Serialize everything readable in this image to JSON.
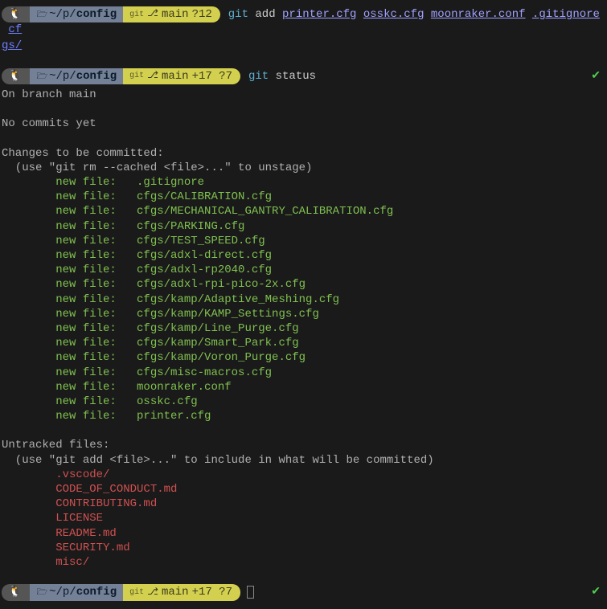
{
  "prompt1": {
    "os_icon": "🐧",
    "path_prefix": "~/p/",
    "path_bold": "config",
    "git_label": "git",
    "branch_icon": "⎇",
    "branch": "main",
    "status_suffix": "?12",
    "cmd": "git",
    "cmd_arg": "add",
    "files": [
      "printer.cfg",
      "osskc.cfg",
      "moonraker.conf",
      ".gitignore"
    ],
    "file_wrap1": "cf",
    "file_wrap2": "gs/"
  },
  "prompt2": {
    "os_icon": "🐧",
    "path_prefix": "~/p/",
    "path_bold": "config",
    "git_label": "git",
    "branch_icon": "⎇",
    "branch": "main",
    "status_suffix": "+17 ?7",
    "cmd": "git",
    "cmd_arg": "status",
    "check": "✔"
  },
  "output": {
    "line1": "On branch main",
    "line2": "",
    "line3": "No commits yet",
    "line4": "",
    "changes_header": "Changes to be committed:",
    "changes_hint": "  (use \"git rm --cached <file>...\" to unstage)",
    "new_file_label": "new file:   ",
    "staged": [
      ".gitignore",
      "cfgs/CALIBRATION.cfg",
      "cfgs/MECHANICAL_GANTRY_CALIBRATION.cfg",
      "cfgs/PARKING.cfg",
      "cfgs/TEST_SPEED.cfg",
      "cfgs/adxl-direct.cfg",
      "cfgs/adxl-rp2040.cfg",
      "cfgs/adxl-rpi-pico-2x.cfg",
      "cfgs/kamp/Adaptive_Meshing.cfg",
      "cfgs/kamp/KAMP_Settings.cfg",
      "cfgs/kamp/Line_Purge.cfg",
      "cfgs/kamp/Smart_Park.cfg",
      "cfgs/kamp/Voron_Purge.cfg",
      "cfgs/misc-macros.cfg",
      "moonraker.conf",
      "osskc.cfg",
      "printer.cfg"
    ],
    "untracked_header": "Untracked files:",
    "untracked_hint": "  (use \"git add <file>...\" to include in what will be committed)",
    "untracked": [
      ".vscode/",
      "CODE_OF_CONDUCT.md",
      "CONTRIBUTING.md",
      "LICENSE",
      "README.md",
      "SECURITY.md",
      "misc/"
    ]
  },
  "prompt3": {
    "os_icon": "🐧",
    "path_prefix": "~/p/",
    "path_bold": "config",
    "git_label": "git",
    "branch_icon": "⎇",
    "branch": "main",
    "status_suffix": "+17 ?7",
    "check": "✔"
  }
}
